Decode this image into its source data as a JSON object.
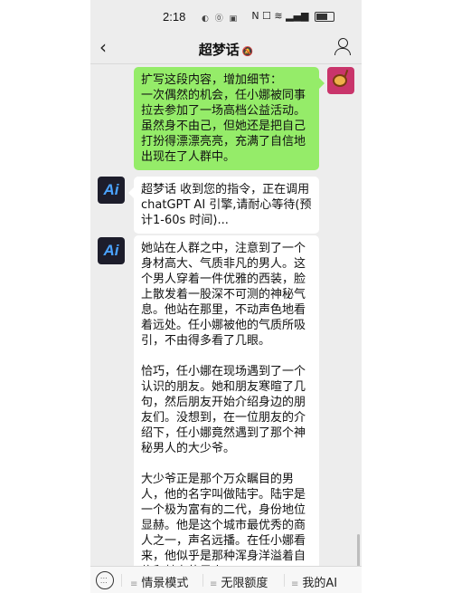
{
  "status": {
    "time": "2:18",
    "indicators": "◐ ⓪ ▣",
    "network": "N ☐ ≋ ▂▄▆"
  },
  "header": {
    "back_label": "‹",
    "title": "超梦话",
    "mute_icon": "🔕"
  },
  "messages": [
    {
      "sender": "user",
      "text": "扩写这段内容，增加细节：\n一次偶然的机会，任小娜被同事拉去参加了一场高档公益活动。虽然身不由己，但她还是把自己打扮得漂漂亮亮，充满了自信地出现在了人群中。"
    },
    {
      "sender": "bot",
      "avatar_label": "Ai",
      "text": "超梦话 收到您的指令，正在调用chatGPT AI 引擎,请耐心等待(预计1-60s 时间)..."
    },
    {
      "sender": "bot",
      "avatar_label": "Ai",
      "text": "她站在人群之中，注意到了一个身材高大、气质非凡的男人。这个男人穿着一件优雅的西装，脸上散发着一股深不可测的神秘气息。他站在那里，不动声色地看着远处。任小娜被他的气质所吸引，不由得多看了几眼。\n\n恰巧，任小娜在现场遇到了一个认识的朋友。她和朋友寒暄了几句，然后朋友开始介绍身边的朋友们。没想到，在一位朋友的介绍下，任小娜竟然遇到了那个神秘男人的大少爷。\n\n大少爷正是那个万众瞩目的男人，他的名字叫做陆宇。陆宇是一个极为富有的二代，身份地位显赫。他是这个城市最优秀的商人之一，声名远播。在任小娜看来，他似乎是那种浑身洋溢着自信和魅力的男人"
    }
  ],
  "bottom_menu": {
    "item1": "情景模式",
    "item2": "无限额度",
    "item3": "我的AI"
  },
  "colors": {
    "user_bubble": "#95ec69",
    "bot_bubble": "#ffffff",
    "background": "#ededed"
  }
}
